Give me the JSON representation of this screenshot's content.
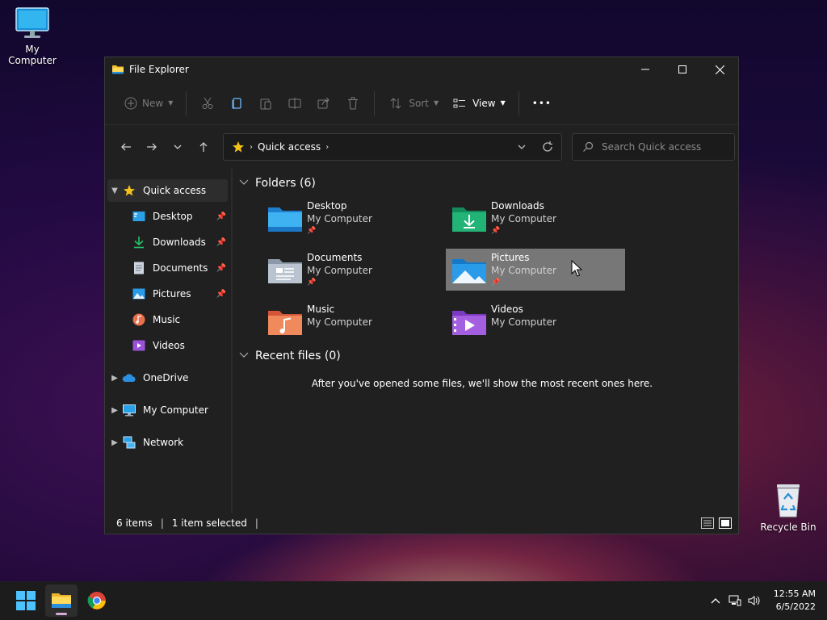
{
  "desktop": {
    "my_computer_label": "My Computer",
    "recycle_bin_label": "Recycle Bin"
  },
  "window": {
    "title": "File Explorer",
    "controls": {
      "minimize": "—",
      "maximize": "☐",
      "close": "✕"
    }
  },
  "toolbar": {
    "new_label": "New",
    "sort_label": "Sort",
    "view_label": "View",
    "more_label": "•••"
  },
  "address": {
    "location": "Quick access"
  },
  "search": {
    "placeholder": "Search Quick access"
  },
  "sidebar": {
    "quick_access": "Quick access",
    "children": [
      {
        "label": "Desktop",
        "pinned": true
      },
      {
        "label": "Downloads",
        "pinned": true
      },
      {
        "label": "Documents",
        "pinned": true
      },
      {
        "label": "Pictures",
        "pinned": true
      },
      {
        "label": "Music",
        "pinned": false
      },
      {
        "label": "Videos",
        "pinned": false
      }
    ],
    "onedrive": "OneDrive",
    "my_computer": "My Computer",
    "network": "Network"
  },
  "content": {
    "folders_header": "Folders (6)",
    "folders": [
      {
        "name": "Desktop",
        "location": "My Computer",
        "pinned": true
      },
      {
        "name": "Downloads",
        "location": "My Computer",
        "pinned": true
      },
      {
        "name": "Documents",
        "location": "My Computer",
        "pinned": true
      },
      {
        "name": "Pictures",
        "location": "My Computer",
        "pinned": true,
        "selected": true
      },
      {
        "name": "Music",
        "location": "My Computer",
        "pinned": false
      },
      {
        "name": "Videos",
        "location": "My Computer",
        "pinned": false
      }
    ],
    "recent_header": "Recent files (0)",
    "recent_empty": "After you've opened some files, we'll show the most recent ones here."
  },
  "statusbar": {
    "items": "6 items",
    "selected": "1 item selected"
  },
  "taskbar": {
    "time": "12:55 AM",
    "date": "6/5/2022"
  },
  "colors": {
    "window_bg": "#202020",
    "selection": "#777777",
    "accent_blue": "#0a84d6"
  }
}
